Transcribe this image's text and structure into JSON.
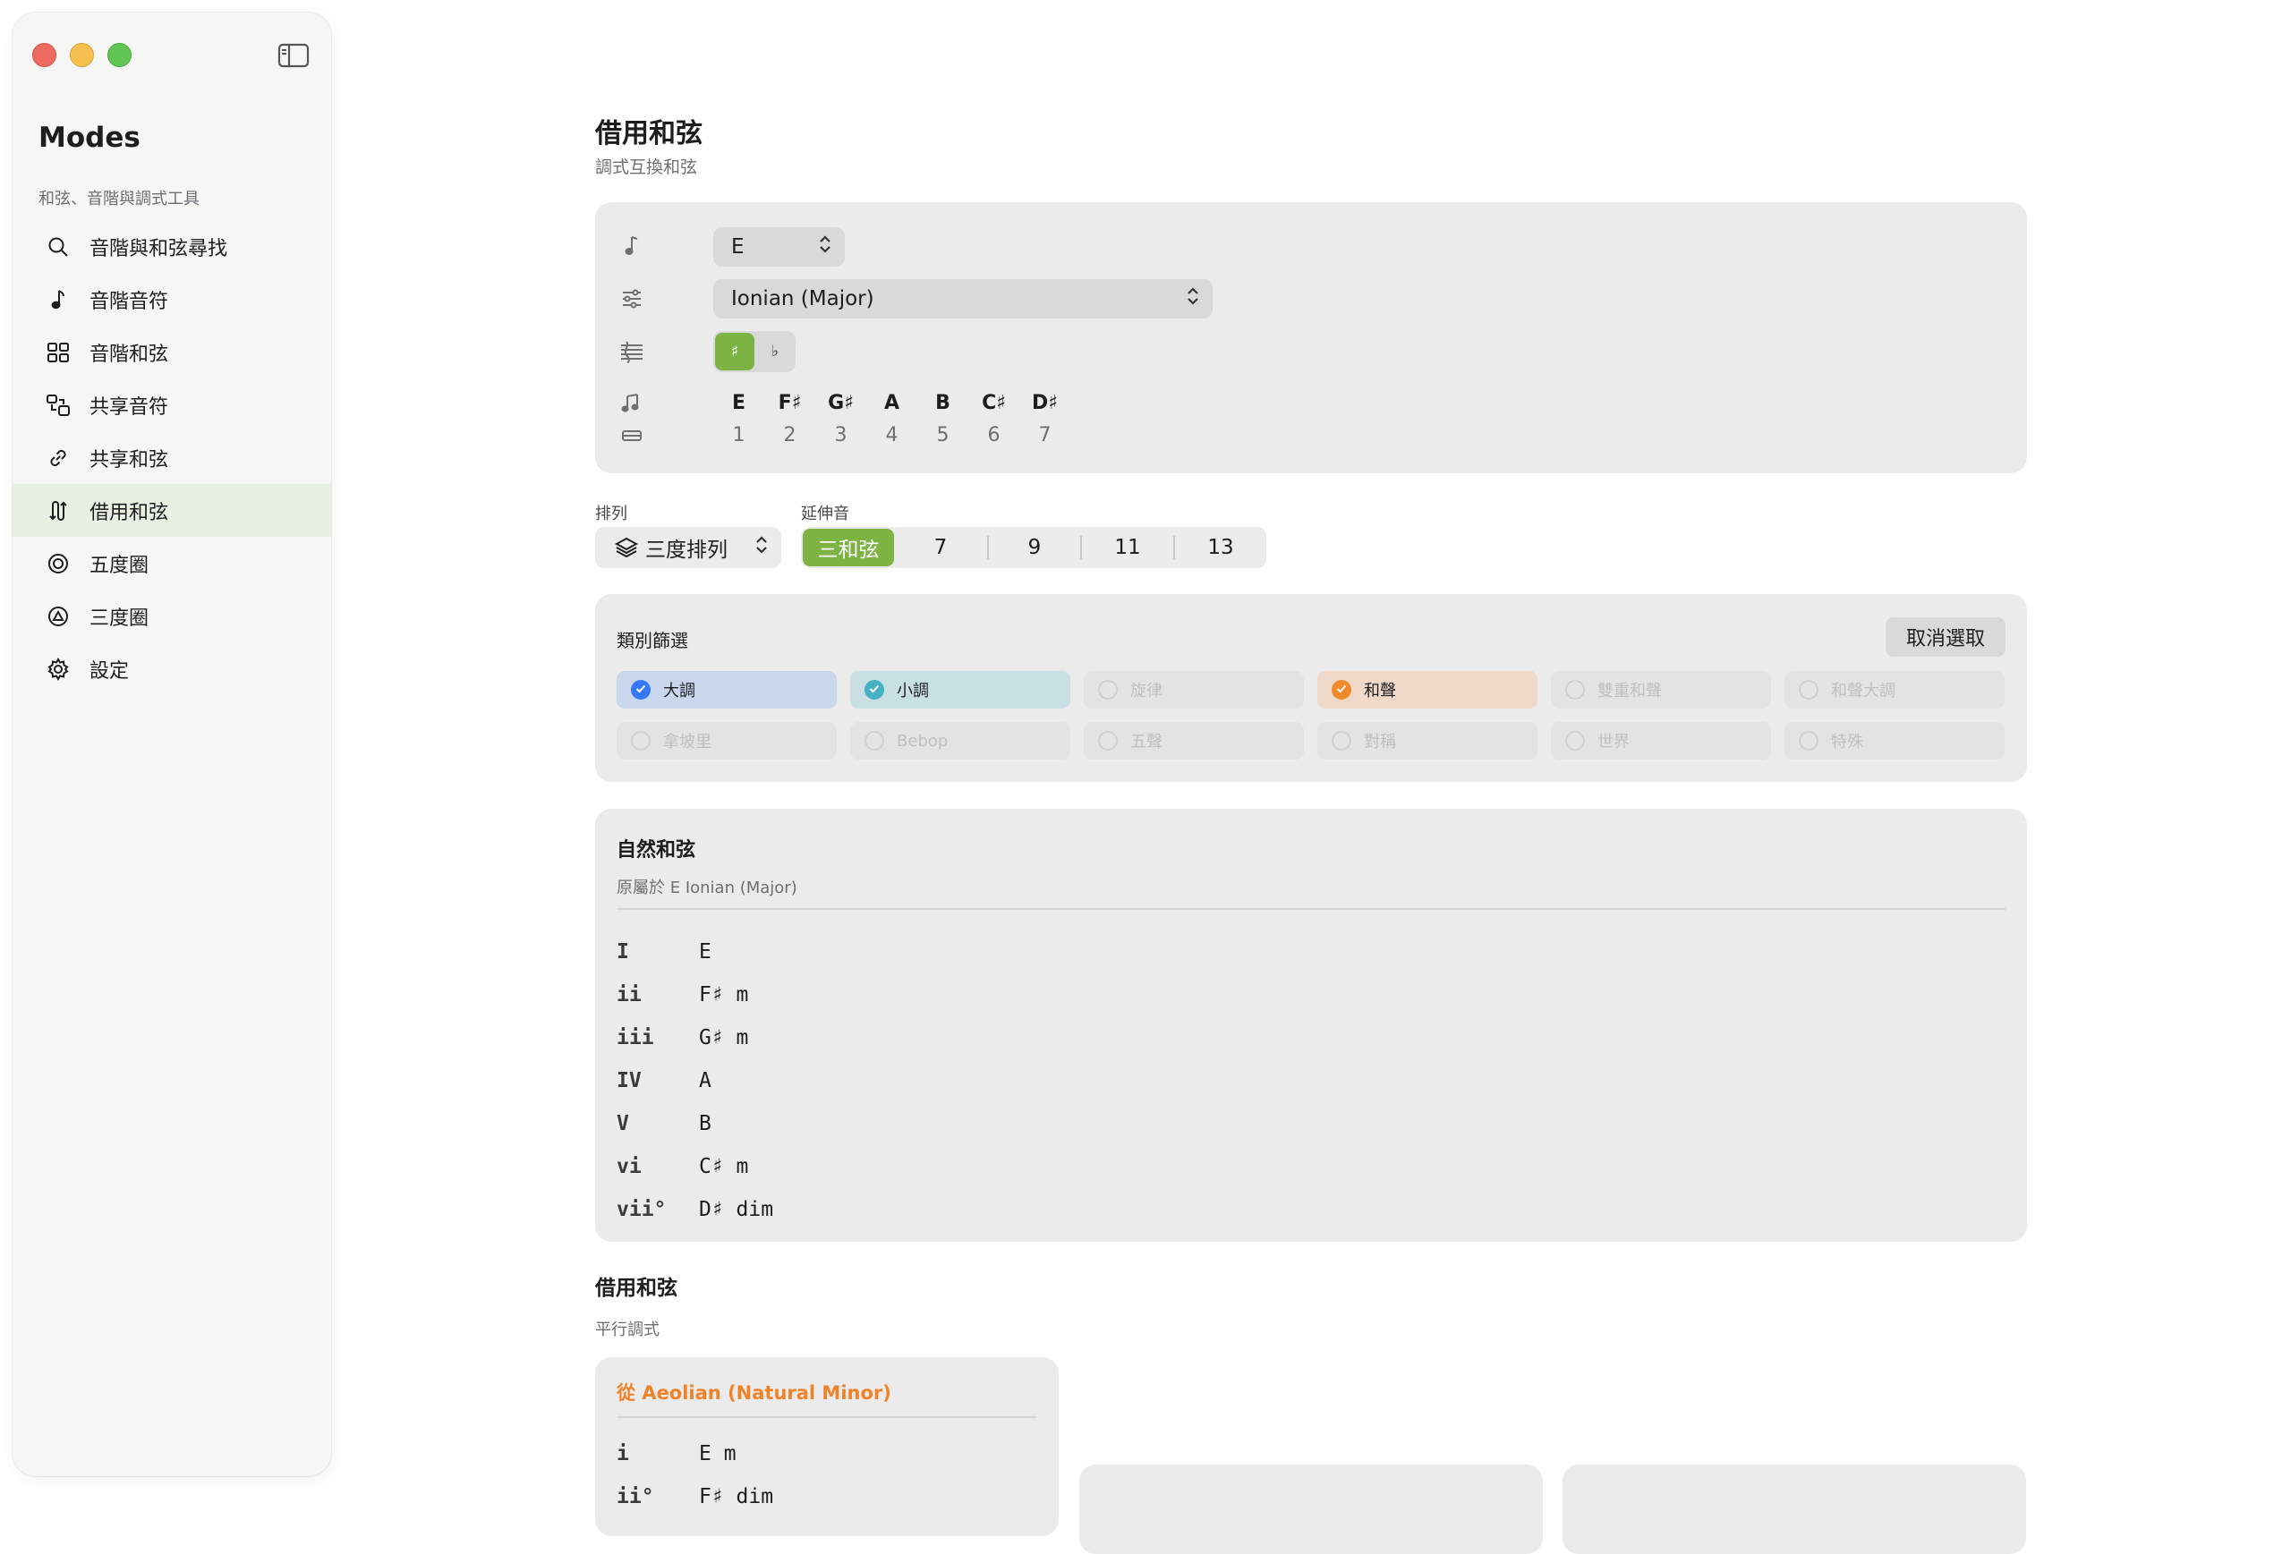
{
  "app": {
    "title": "Modes",
    "subtitle": "和弦、音階與調式工具"
  },
  "sidebar": {
    "items": [
      {
        "label": "音階與和弦尋找",
        "icon": "search-icon",
        "active": false
      },
      {
        "label": "音階音符",
        "icon": "music-note-icon",
        "active": false
      },
      {
        "label": "音階和弦",
        "icon": "grid-icon",
        "active": false
      },
      {
        "label": "共享音符",
        "icon": "shared-shapes-icon",
        "active": false
      },
      {
        "label": "共享和弦",
        "icon": "link-icon",
        "active": false
      },
      {
        "label": "借用和弦",
        "icon": "borrow-arrows-icon",
        "active": true
      },
      {
        "label": "五度圈",
        "icon": "circle-target-icon",
        "active": false
      },
      {
        "label": "三度圈",
        "icon": "circle-triangle-icon",
        "active": false
      },
      {
        "label": "設定",
        "icon": "gear-icon",
        "active": false
      }
    ]
  },
  "page": {
    "title": "借用和弦",
    "subtitle": "調式互換和弦"
  },
  "controls": {
    "key_value": "E",
    "mode_value": "Ionian (Major)",
    "sharp_label": "♯",
    "flat_label": "♭",
    "notes": [
      "E",
      "F♯",
      "G♯",
      "A",
      "B",
      "C♯",
      "D♯"
    ],
    "degrees": [
      "1",
      "2",
      "3",
      "4",
      "5",
      "6",
      "7"
    ]
  },
  "arrangement": {
    "label": "排列",
    "value": "三度排列",
    "extension_label": "延伸音",
    "extensions": [
      "三和弦",
      "7",
      "9",
      "11",
      "13"
    ]
  },
  "filters": {
    "title": "類別篩選",
    "deselect_label": "取消選取",
    "row1": [
      "大調",
      "小調",
      "旋律",
      "和聲",
      "雙重和聲",
      "和聲大調"
    ],
    "row2": [
      "拿坡里",
      "Bebop",
      "五聲",
      "對稱",
      "世界",
      "特殊"
    ]
  },
  "diatonic": {
    "title": "自然和弦",
    "subtitle": "原屬於 E Ionian (Major)",
    "chords": [
      {
        "numeral": "I",
        "name": "E"
      },
      {
        "numeral": "ii",
        "name": "F♯ m"
      },
      {
        "numeral": "iii",
        "name": "G♯ m"
      },
      {
        "numeral": "IV",
        "name": "A"
      },
      {
        "numeral": "V",
        "name": "B"
      },
      {
        "numeral": "vi",
        "name": "C♯ m"
      },
      {
        "numeral": "vii°",
        "name": "D♯ dim"
      }
    ]
  },
  "borrowed": {
    "title": "借用和弦",
    "subtitle": "平行調式",
    "cards": [
      {
        "title": "從 Aeolian (Natural Minor)",
        "chords": [
          {
            "numeral": "i",
            "name": "E m"
          },
          {
            "numeral": "ii°",
            "name": "F♯ dim"
          }
        ]
      }
    ]
  },
  "colors": {
    "accent": "#7cb342",
    "major": "#3478f6",
    "minor": "#45b0c2",
    "harmonic": "#f08a2b"
  }
}
